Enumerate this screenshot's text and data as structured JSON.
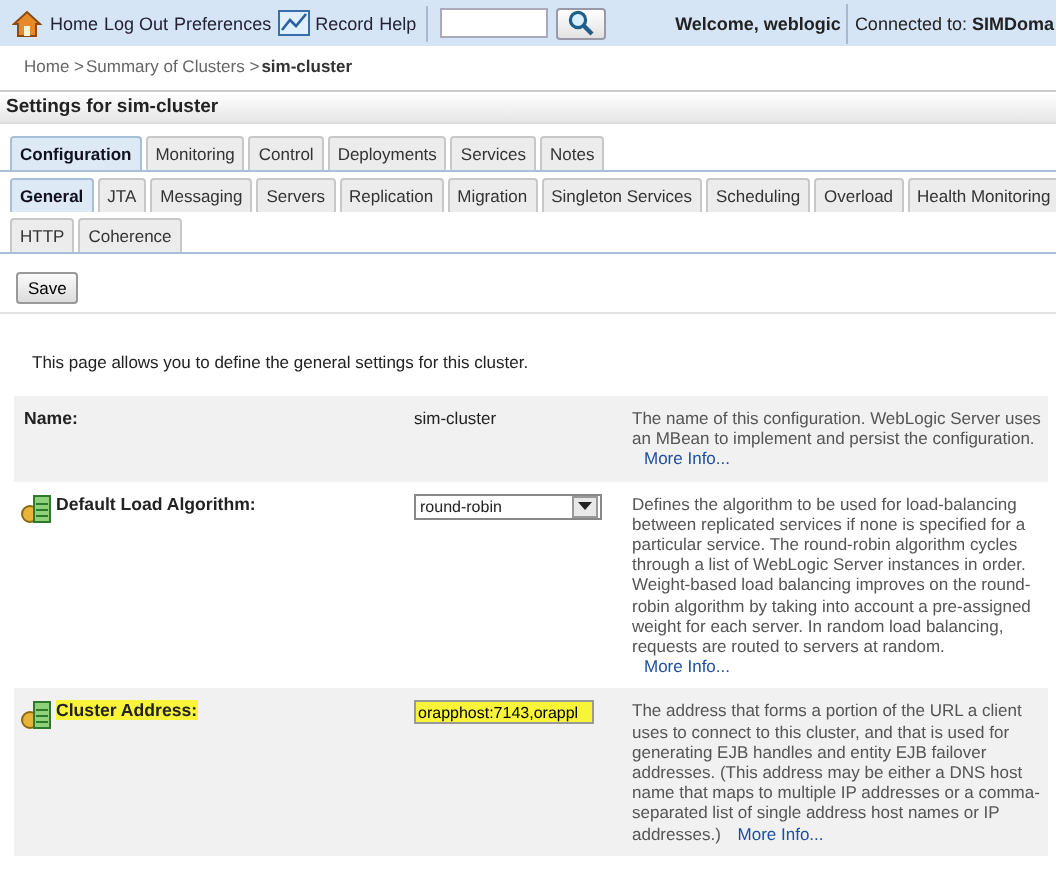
{
  "top_bar": {
    "links": [
      {
        "label": "Home"
      },
      {
        "label": "Log Out"
      },
      {
        "label": "Preferences"
      },
      {
        "label": "Record"
      },
      {
        "label": "Help"
      }
    ],
    "welcome": "Welcome, weblogic",
    "connection": "Connected to: **SIMDoma**"
  },
  "breadcrumb": [
    {
      "label": "Home >",
      "current": false
    },
    {
      "label": "Summary of Clusters >",
      "current": false
    },
    {
      "label": "sim-cluster",
      "current": true
    }
  ],
  "title": "Settings for sim-cluster",
  "tabs": [
    {
      "label": "Configuration",
      "selected": true
    },
    {
      "label": "Monitoring",
      "selected": false
    },
    {
      "label": "Control",
      "selected": false
    },
    {
      "label": "Deployments",
      "selected": false
    },
    {
      "label": "Services",
      "selected": false
    },
    {
      "label": "Notes",
      "selected": false
    }
  ],
  "subtab_rows": [
    [
      {
        "label": "General",
        "selected": true
      },
      {
        "label": "JTA",
        "selected": false
      },
      {
        "label": "Messaging",
        "selected": false
      },
      {
        "label": "Servers",
        "selected": false
      },
      {
        "label": "Replication",
        "selected": false
      },
      {
        "label": "Migration",
        "selected": false
      },
      {
        "label": "Singleton Services",
        "selected": false
      },
      {
        "label": "Scheduling",
        "selected": false
      },
      {
        "label": "Overload",
        "selected": false
      },
      {
        "label": "Health Monitoring",
        "selected": false
      }
    ],
    [
      {
        "label": "HTTP",
        "selected": false
      },
      {
        "label": "Coherence",
        "selected": false
      }
    ]
  ],
  "save_button": "Save",
  "intro": "This page allows you to define the general settings for this cluster.",
  "settings": [
    {
      "label": "Name:",
      "kind": "text",
      "value": "sim-cluster",
      "has_icon": false,
      "highlighted": false,
      "description": "The name of this configuration. WebLogic Server uses an MBean to implement and persist the configuration.",
      "link": "More Info..."
    },
    {
      "label": "Default Load Algorithm:",
      "kind": "select",
      "value": "round-robin",
      "has_icon": true,
      "highlighted": false,
      "description": "Defines the algorithm to be used for load-balancing between replicated services if none is specified for a particular service. The round-robin algorithm cycles through a list of WebLogic Server instances in order. Weight-based load balancing improves on the round-robin algorithm by taking into account a pre-assigned weight for each server. In random load balancing, requests are routed to servers at random.",
      "link": "More Info..."
    },
    {
      "label": "Cluster Address:",
      "kind": "input",
      "value": "orapphost:7143,orappl",
      "has_icon": true,
      "highlighted": true,
      "description": "The address that forms a portion of the URL a client uses to connect to this cluster, and that is used for generating EJB handles and entity EJB failover addresses. (This address may be either a DNS host name that maps to multiple IP addresses or a comma-separated list of single address host names or IP addresses.)",
      "link": "More Info..."
    }
  ]
}
